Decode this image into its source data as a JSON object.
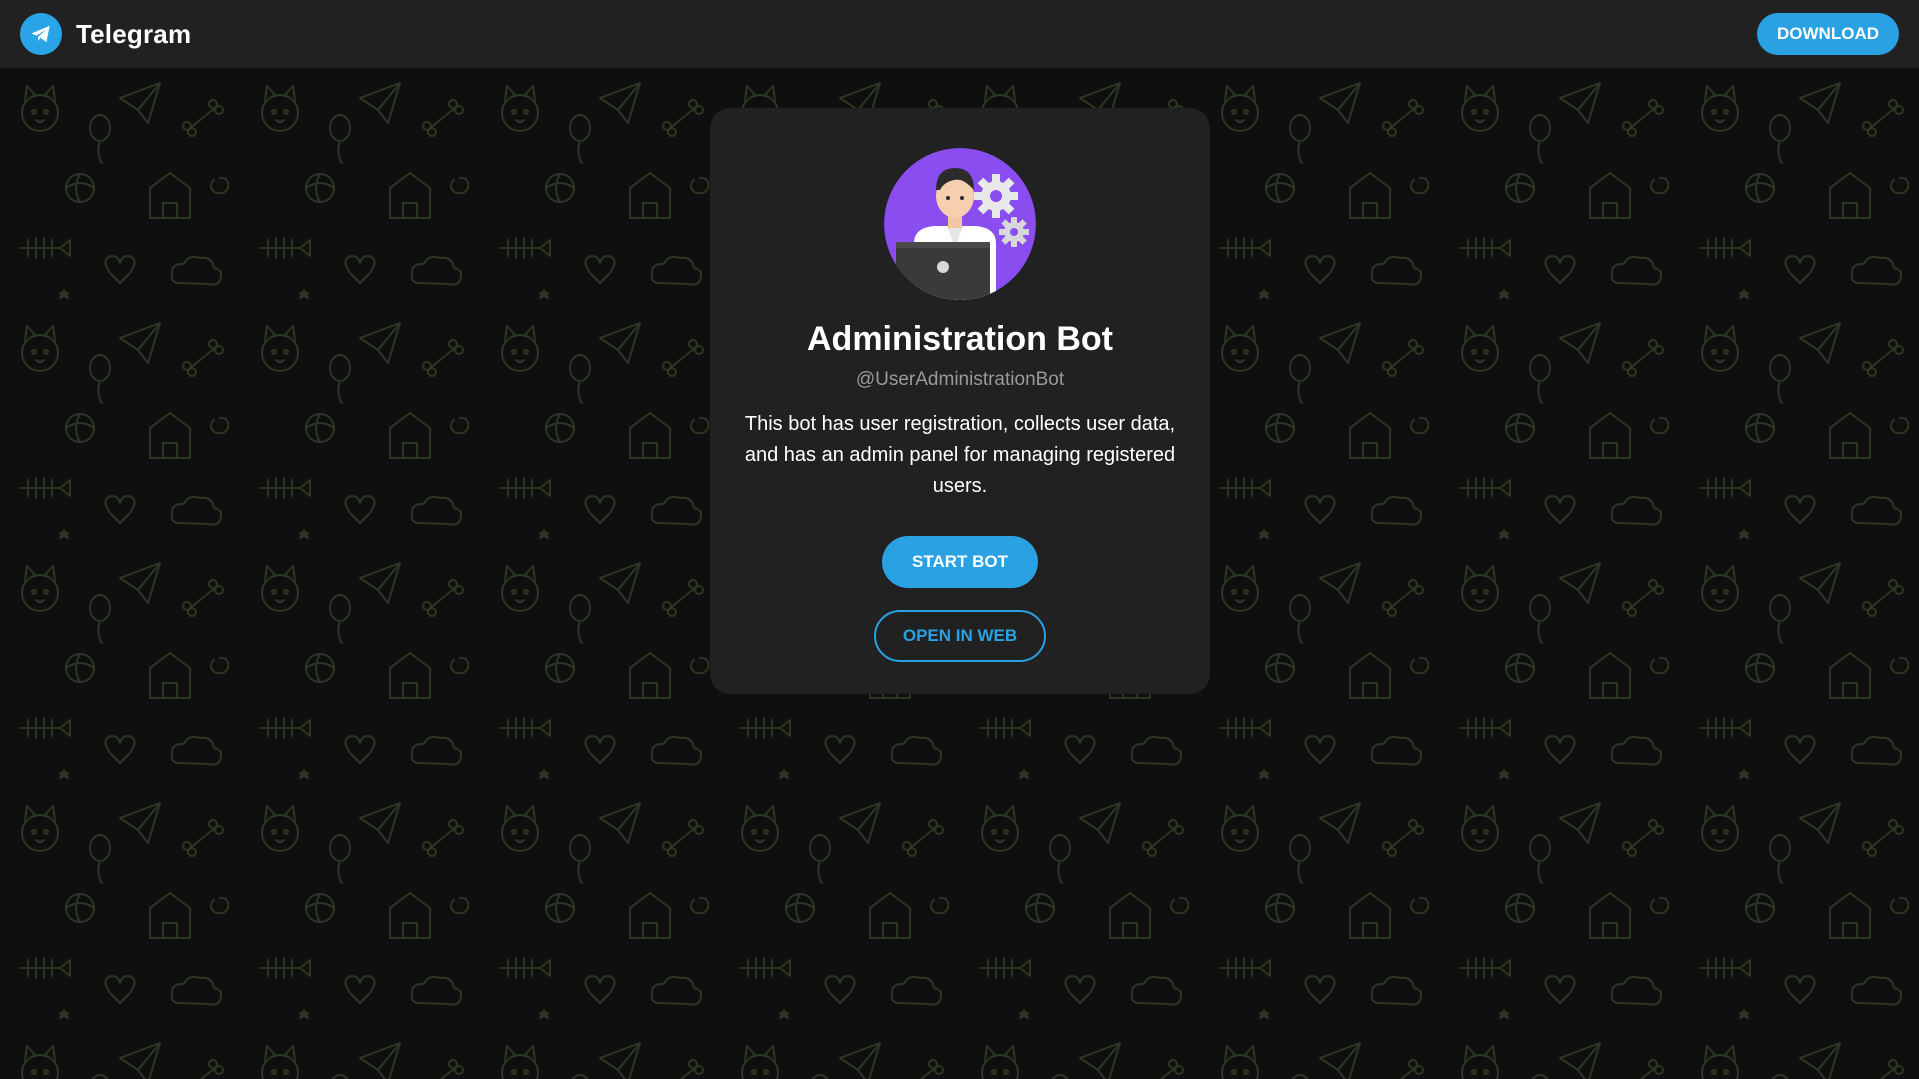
{
  "header": {
    "brand": "Telegram",
    "download_label": "DOWNLOAD",
    "logo_icon": "telegram-plane-icon"
  },
  "bot": {
    "name": "Administration Bot",
    "username": "@UserAdministrationBot",
    "description": "This bot has user registration, collects user data, and has an admin panel for managing registered users.",
    "avatar_icon": "admin-with-laptop-and-gears"
  },
  "actions": {
    "start_label": "START BOT",
    "open_web_label": "OPEN IN WEB"
  },
  "colors": {
    "accent": "#2aa1e3",
    "background": "#0f0f0f",
    "card": "#212121",
    "pattern": "#2c3a22"
  }
}
